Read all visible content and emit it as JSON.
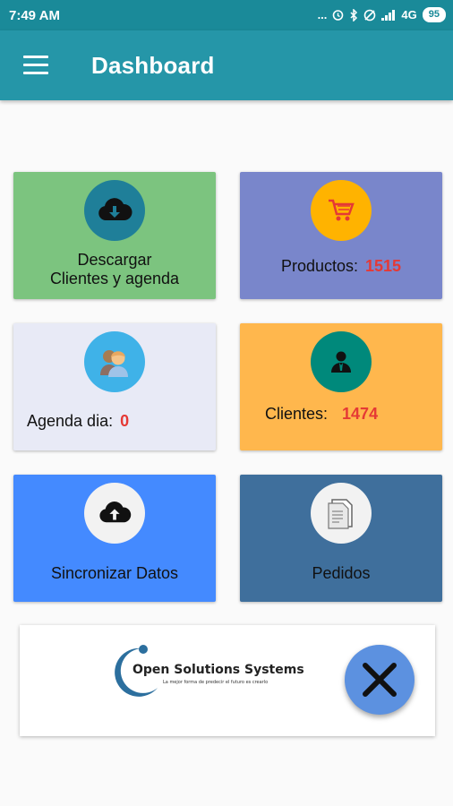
{
  "status_bar": {
    "time": "7:49 AM",
    "signal_text": "...",
    "network": "4G",
    "battery": "95"
  },
  "app_bar": {
    "title": "Dashboard"
  },
  "cards": {
    "download": {
      "line1": "Descargar",
      "line2": "Clientes y agenda",
      "color": "#7cc47f"
    },
    "products": {
      "label": "Productos:",
      "count": "1515",
      "color": "#7986cb"
    },
    "agenda": {
      "label": "Agenda dia:",
      "count": "0",
      "color": "#e8eaf6"
    },
    "clients": {
      "label": "Clientes:",
      "count": "1474",
      "color": "#ffb74d"
    },
    "sync": {
      "label": "Sincronizar Datos",
      "color": "#448aff"
    },
    "orders": {
      "label": "Pedidos",
      "color": "#3f6f9c"
    }
  },
  "ad": {
    "brand": "Open Solutions Systems",
    "tagline": "La mejor forma de predecir el futuro es crearlo"
  },
  "icons": {
    "download": "cloud-download-icon",
    "products": "shopping-cart-icon",
    "agenda": "people-icon",
    "clients": "person-icon",
    "sync": "cloud-upload-icon",
    "orders": "document-icon",
    "close": "close-icon"
  },
  "colors": {
    "status_bar": "#1a8a99",
    "app_bar": "#2596a8",
    "count": "#e53935",
    "fab": "#5c91e0"
  }
}
